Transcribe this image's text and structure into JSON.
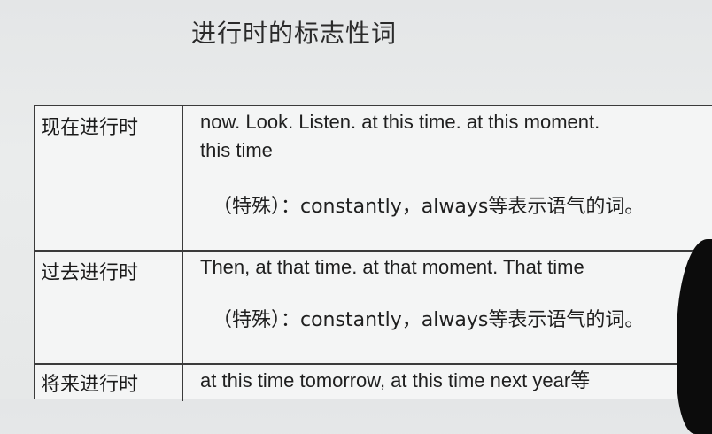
{
  "title": "进行时的标志性词",
  "rows": [
    {
      "tense": "现在进行时",
      "words_line1": "now.  Look.  Listen.  at this time.  at this moment.",
      "words_line2": "this time",
      "special": "（特殊）：constantly，always等表示语气的词。"
    },
    {
      "tense": "过去进行时",
      "words_line1": "Then,  at that time. at that moment.  That time",
      "special": "（特殊）：constantly，always等表示语气的词。"
    },
    {
      "tense": "将来进行时",
      "words_line1": "at this time tomorrow,  at this time next year等"
    }
  ]
}
